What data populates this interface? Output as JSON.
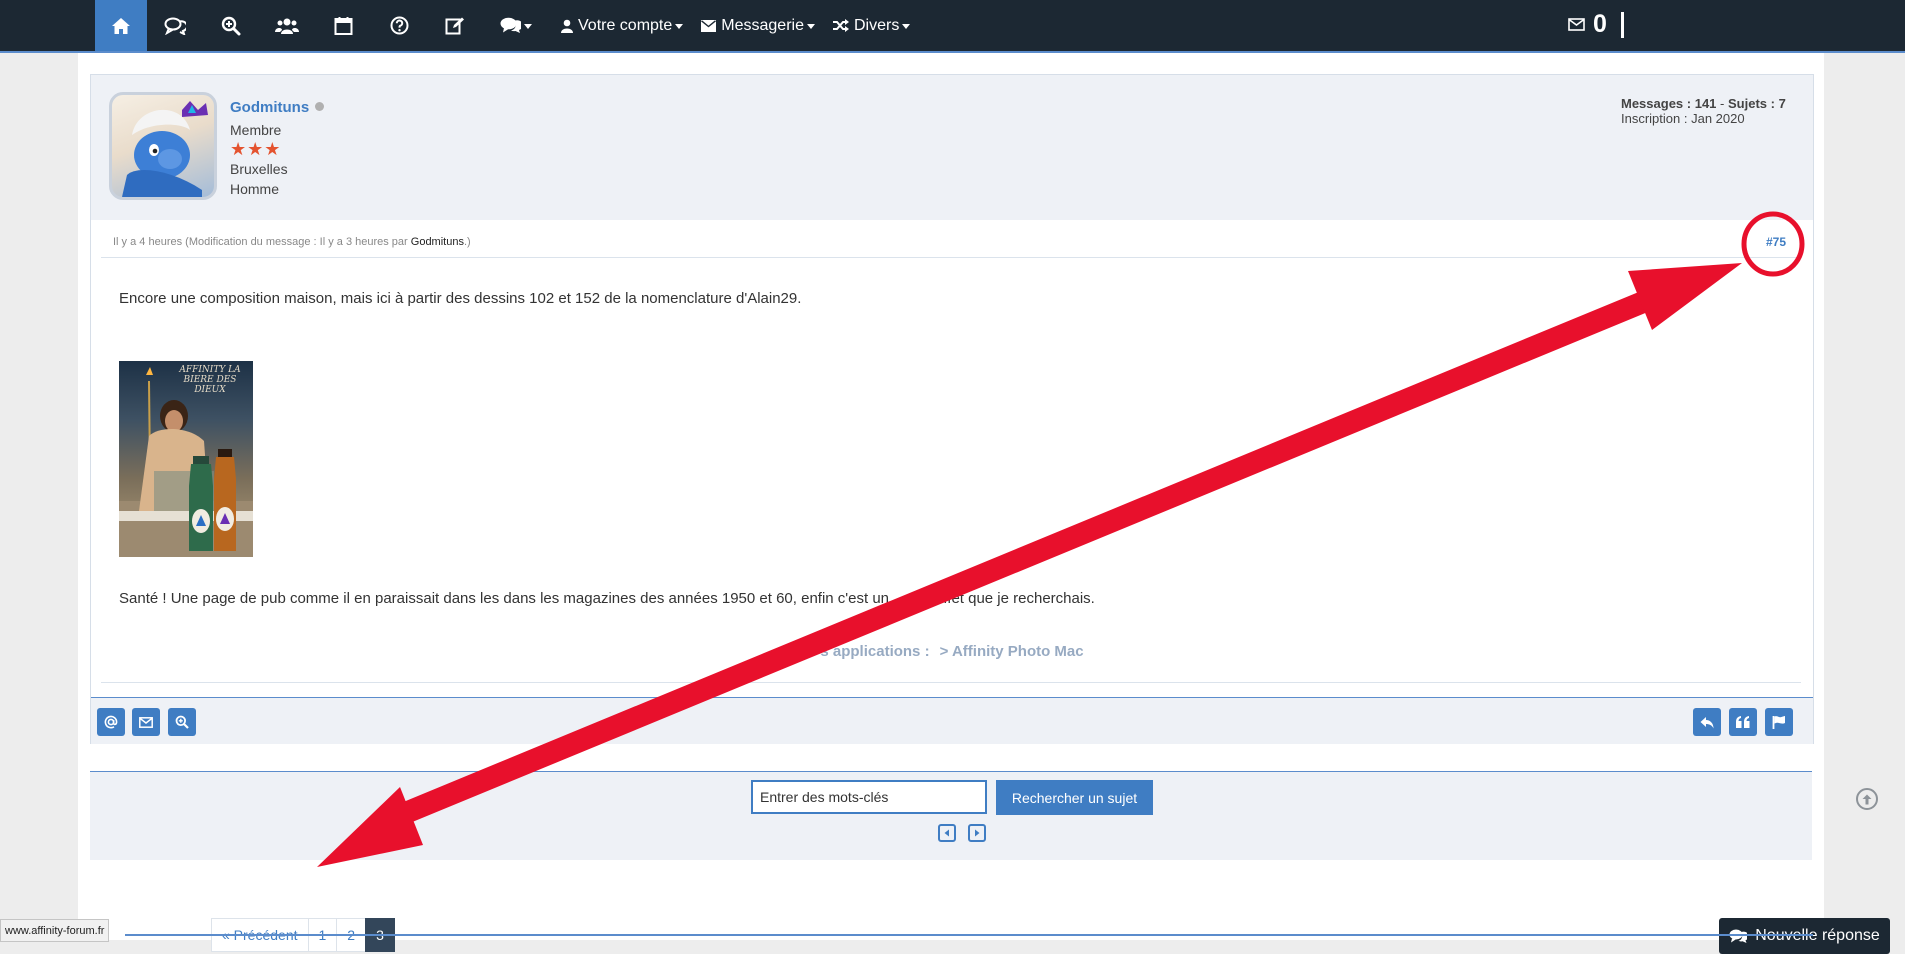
{
  "navbar": {
    "items": [
      {
        "icon": "home-icon"
      },
      {
        "icon": "chat-bubbles-icon"
      },
      {
        "icon": "zoom-in-icon"
      },
      {
        "icon": "users-icon"
      },
      {
        "icon": "calendar-icon"
      },
      {
        "icon": "help-circle-icon"
      },
      {
        "icon": "edit-icon"
      },
      {
        "icon": "comments-dropdown-icon"
      }
    ],
    "account_label": "Votre compte",
    "messages_label": "Messagerie",
    "misc_label": "Divers",
    "mail_count": "0"
  },
  "post": {
    "username": "Godmituns",
    "role": "Membre",
    "stars": "★★★",
    "city": "Bruxelles",
    "gender": "Homme",
    "stats_messages_label": "Messages :",
    "stats_messages": "141",
    "stats_subjects_label": "Sujets :",
    "stats_subjects": "7",
    "stats_signup_label": "Inscription :",
    "stats_signup": "Jan 2020",
    "meta_time": "Il y a 4 heures (Modification du message : Il y a 3 heures par ",
    "meta_by": "Godmituns",
    "meta_end": ".)",
    "post_number": "#75",
    "text1": "Encore une composition maison, mais ici à partir des dessins 102 et 152 de la nomenclature d'Alain29.",
    "image_title": "AFFINITY LA BIERE DES DIEUX",
    "text2_left": "Santé ! Une page de pub comme il en paraissait dans les dans les magazines des années 1950 et 60, enfin c'est un",
    "text2_right": "effet que je recherchais.",
    "apps_label": "s applications :",
    "apps_value": "> Affinity Photo Mac"
  },
  "search": {
    "placeholder": "Entrer des mots-clés",
    "button_label": "Rechercher un sujet"
  },
  "pagination": {
    "prev_label": "« Précédent",
    "pages": [
      "1",
      "2",
      "3"
    ],
    "active_page": "3"
  },
  "reply_button_label": "Nouvelle réponse",
  "status_url": "www.affinity-forum.fr",
  "annotation": {
    "color": "#e8102c"
  }
}
